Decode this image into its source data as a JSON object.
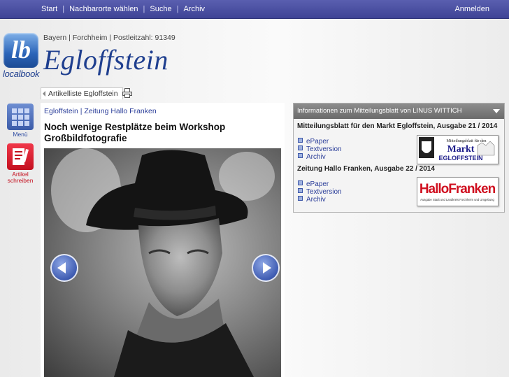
{
  "nav": {
    "items": [
      "Start",
      "Nachbarorte wählen",
      "Suche",
      "Archiv"
    ],
    "login": "Anmelden"
  },
  "header": {
    "logo_mark": "lb",
    "logo_text": "localbook",
    "breadcrumb": "Bayern | Forchheim | Postleitzahl: 91349",
    "title": "Egloffstein"
  },
  "tabs": {
    "articles": "Artikelliste Egloffstein"
  },
  "sidebar": {
    "menu": "Menü",
    "write_line1": "Artikel",
    "write_line2": "schreiben"
  },
  "article": {
    "category": "Egloffstein | Zeitung Hallo Franken",
    "title": "Noch wenige Restplätze beim Workshop Großbildfotografie"
  },
  "info": {
    "header": "Informationen zum Mitteilungsblatt von LINUS WITTICH",
    "sections": [
      {
        "title": "Mitteilungsblatt für den Markt Egloffstein, Ausgabe 21 / 2014",
        "links": [
          "ePaper",
          "Textversion",
          "Archiv"
        ],
        "thumb": {
          "line1": "Mitteilungsblatt für den",
          "line2": "Markt",
          "line3": "EGLOFFSTEIN"
        }
      },
      {
        "title": "Zeitung Hallo Franken, Ausgabe 22 / 2014",
        "links": [
          "ePaper",
          "Textversion",
          "Archiv"
        ],
        "thumb": {
          "line1": "HalloFranken",
          "line2": "Ausgabe Stadt und Landkreis Forchheim und Umgebung"
        }
      }
    ]
  },
  "colors": {
    "brand_blue": "#1f3f8f",
    "nav": "#454a9c",
    "accent_red": "#c4101f"
  }
}
